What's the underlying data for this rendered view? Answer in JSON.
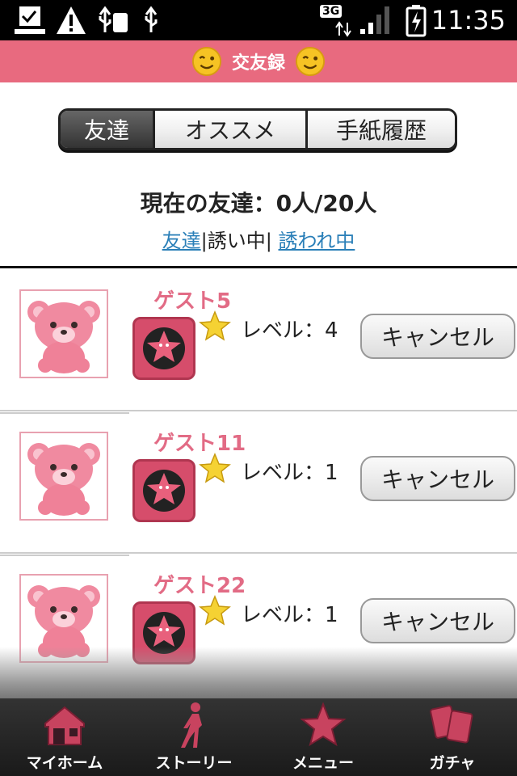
{
  "status_bar": {
    "network": "3G",
    "time": "11:35"
  },
  "header": {
    "title": "交友録"
  },
  "tabs": [
    {
      "label": "友達",
      "active": true
    },
    {
      "label": "オススメ",
      "active": false
    },
    {
      "label": "手紙履歴",
      "active": false
    }
  ],
  "summary": {
    "text": "現在の友達：0人/20人"
  },
  "filters": {
    "friends": "友達",
    "sep1": "|",
    "inviting": "誘い中",
    "sep2": "|",
    "invited": "誘われ中"
  },
  "friends": [
    {
      "name": "ゲスト5",
      "level": "レベル：4",
      "action": "キャンセル"
    },
    {
      "name": "ゲスト11",
      "level": "レベル：1",
      "action": "キャンセル"
    },
    {
      "name": "ゲスト22",
      "level": "レベル：1",
      "action": "キャンセル"
    }
  ],
  "bottom_nav": [
    {
      "label": "マイホーム",
      "icon": "home-icon"
    },
    {
      "label": "ストーリー",
      "icon": "walking-person-icon"
    },
    {
      "label": "メニュー",
      "icon": "star-icon"
    },
    {
      "label": "ガチャ",
      "icon": "cards-icon"
    }
  ],
  "colors": {
    "header_pink": "#e86a7f",
    "name_pink": "#e26b85",
    "link_blue": "#2a7fb8",
    "nav_icon": "#c8435f"
  }
}
